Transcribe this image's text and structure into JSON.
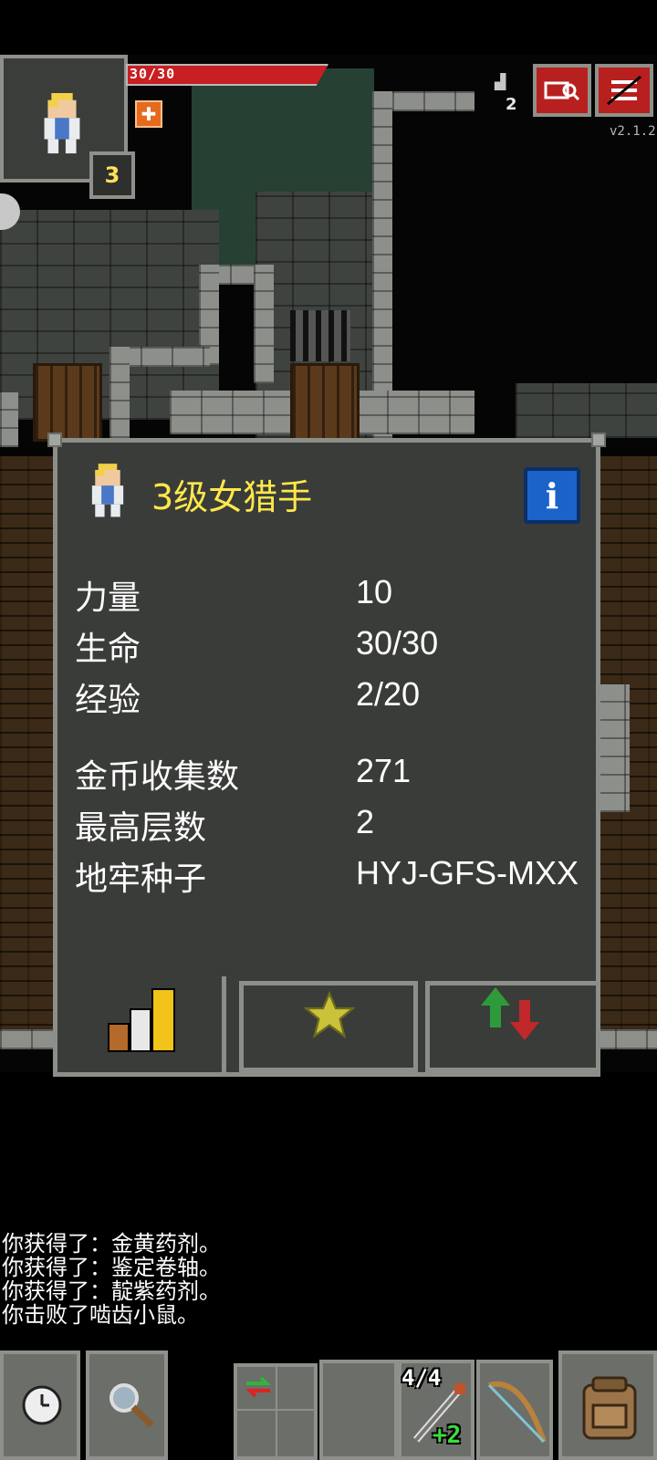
{
  "hud": {
    "hp_text": "30/30",
    "hp_fraction": 1.0,
    "hero_level": "3",
    "depth": "2",
    "version": "v2.1.2",
    "icons": {
      "journal": "journal-search-icon",
      "menu": "menu-icon",
      "depth": "stairs-icon",
      "buff": "targeted-buff-icon"
    }
  },
  "hero_window": {
    "title": "3级女猎手",
    "stats_primary": [
      {
        "label": "力量",
        "value": "10"
      },
      {
        "label": "生命",
        "value": "30/30"
      },
      {
        "label": "经验",
        "value": "2/20"
      }
    ],
    "stats_secondary": [
      {
        "label": "金币收集数",
        "value": "271"
      },
      {
        "label": "最高层数",
        "value": "2"
      },
      {
        "label": "地牢种子",
        "value": "HYJ-GFS-MXX"
      }
    ],
    "tabs": [
      {
        "name": "stats",
        "icon": "bar-chart-icon"
      },
      {
        "name": "badges",
        "icon": "star-icon"
      },
      {
        "name": "journal",
        "icon": "up-down-arrows-icon"
      }
    ]
  },
  "log": [
    "你获得了：金黄药剂。",
    "你获得了：鉴定卷轴。",
    "你获得了：靛紫药剂。",
    "你击败了啮齿小鼠。"
  ],
  "toolbar": {
    "weapon_charges": "4/4",
    "weapon_upgrade": "+2"
  },
  "colors": {
    "title": "#ffe84a",
    "hp": "#c81f22",
    "panel": "#3a3c39",
    "upgrade": "#3ddc3d"
  }
}
